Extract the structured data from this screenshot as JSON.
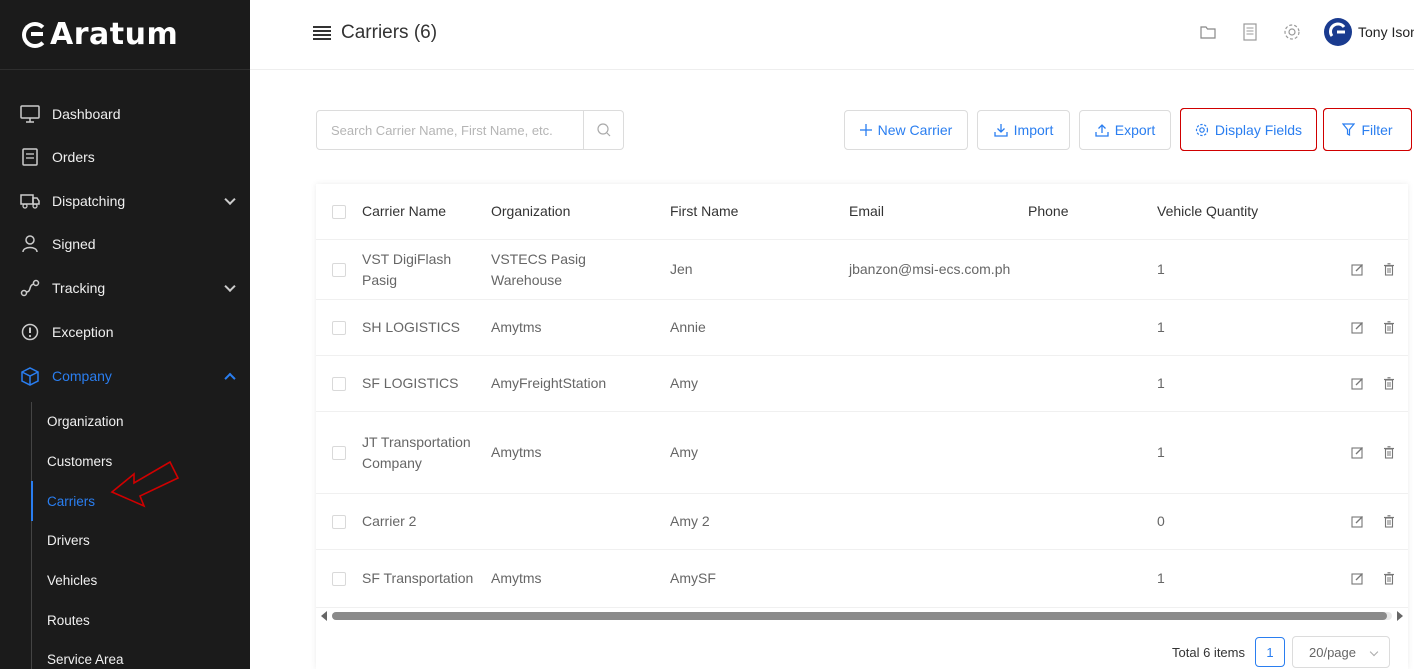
{
  "brand": {
    "name": "Aratum"
  },
  "sidebar": {
    "items": [
      {
        "label": "Dashboard",
        "icon": "monitor-icon"
      },
      {
        "label": "Orders",
        "icon": "orders-icon"
      },
      {
        "label": "Dispatching",
        "icon": "truck-icon",
        "expandable": true
      },
      {
        "label": "Signed",
        "icon": "person-icon"
      },
      {
        "label": "Tracking",
        "icon": "route-icon",
        "expandable": true
      },
      {
        "label": "Exception",
        "icon": "alert-icon"
      },
      {
        "label": "Company",
        "icon": "box-icon",
        "expandable": true,
        "expanded": true,
        "active": true
      }
    ],
    "company_sub": [
      {
        "label": "Organization"
      },
      {
        "label": "Customers"
      },
      {
        "label": "Carriers",
        "active": true
      },
      {
        "label": "Drivers"
      },
      {
        "label": "Vehicles"
      },
      {
        "label": "Routes"
      },
      {
        "label": "Service Area"
      }
    ]
  },
  "header": {
    "title": "Carriers (6)",
    "user_name": "Tony Ison"
  },
  "toolbar": {
    "search_placeholder": "Search Carrier Name, First Name, etc.",
    "new_carrier": "New Carrier",
    "import": "Import",
    "export": "Export",
    "display_fields": "Display Fields",
    "filter": "Filter"
  },
  "table": {
    "columns": [
      "Carrier Name",
      "Organization",
      "First Name",
      "Email",
      "Phone",
      "Vehicle Quantity"
    ],
    "rows": [
      {
        "name": "VST DigiFlash Pasig",
        "org": "VSTECS Pasig Warehouse",
        "first": "Jen",
        "email": "jbanzon@msi-ecs.com.ph",
        "phone": "",
        "vehicles": "1"
      },
      {
        "name": "SH LOGISTICS",
        "org": "Amytms",
        "first": "Annie",
        "email": "",
        "phone": "",
        "vehicles": "1"
      },
      {
        "name": "SF LOGISTICS",
        "org": "AmyFreightStation",
        "first": "Amy",
        "email": "",
        "phone": "",
        "vehicles": "1"
      },
      {
        "name": "JT Transportation Company",
        "org": "Amytms",
        "first": "Amy",
        "email": "",
        "phone": "",
        "vehicles": "1"
      },
      {
        "name": "Carrier 2",
        "org": "",
        "first": "Amy 2",
        "email": "",
        "phone": "",
        "vehicles": "0"
      },
      {
        "name": "SF Transportation",
        "org": "Amytms",
        "first": "AmySF",
        "email": "",
        "phone": "",
        "vehicles": "1"
      }
    ],
    "scroll_position": 0.0
  },
  "pagination": {
    "total": "Total 6 items",
    "current_page": "1",
    "page_size": "20/page"
  },
  "colors": {
    "accent": "#2a7ef0",
    "sidebar_bg": "#1b1b1b",
    "highlight": "#d00000"
  }
}
